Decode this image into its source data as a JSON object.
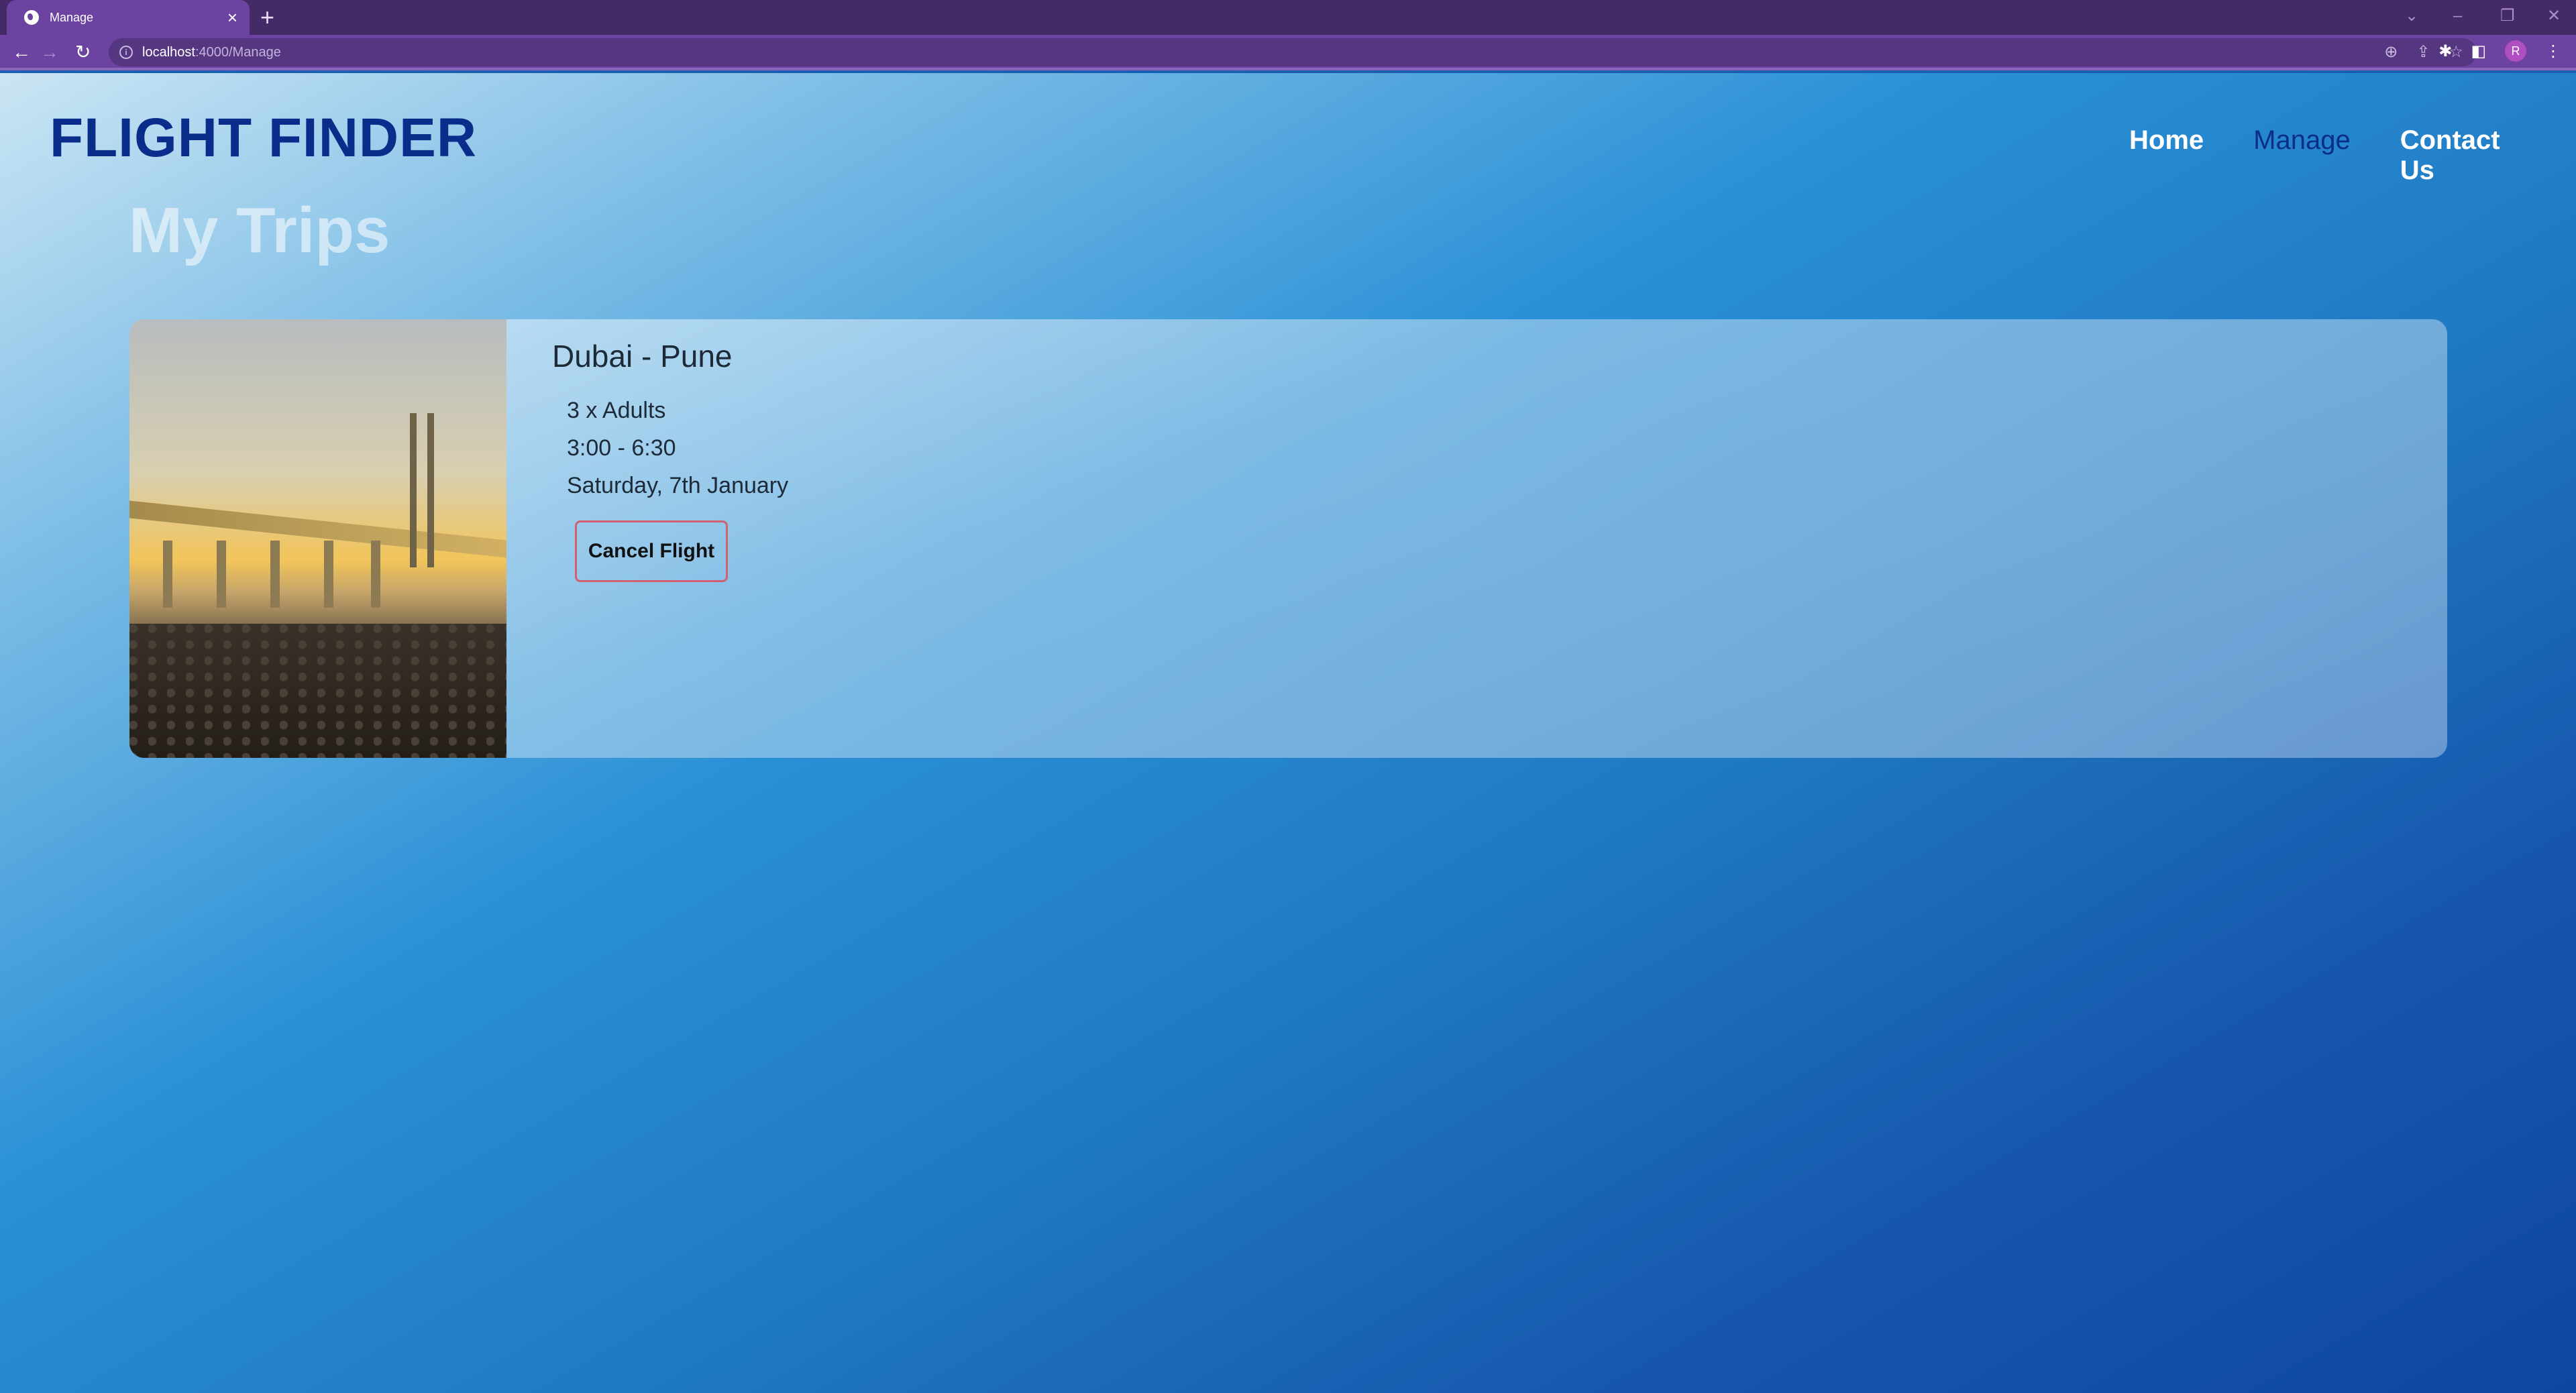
{
  "browser": {
    "tab_title": "Manage",
    "new_tab_label": "+",
    "url_host": "localhost",
    "url_path": ":4000/Manage",
    "profile_initial": "R"
  },
  "site": {
    "brand": "FLIGHT FINDER",
    "nav": [
      {
        "label": "Home",
        "active": false
      },
      {
        "label": "Manage",
        "active": true
      },
      {
        "label": "Contact Us",
        "active": false
      }
    ],
    "page_title": "My Trips"
  },
  "trips": [
    {
      "route": "Dubai - Pune",
      "passengers": "3 x Adults",
      "time": "3:00 - 6:30",
      "date": "Saturday, 7th January",
      "cancel_label": "Cancel Flight",
      "image_alt": "Sea link bridge at sunset"
    }
  ],
  "colors": {
    "brand": "#0a2d8c",
    "active_nav": "#0a2d8c",
    "cancel_border": "#d16070",
    "browser_frame": "#6c43a1"
  }
}
